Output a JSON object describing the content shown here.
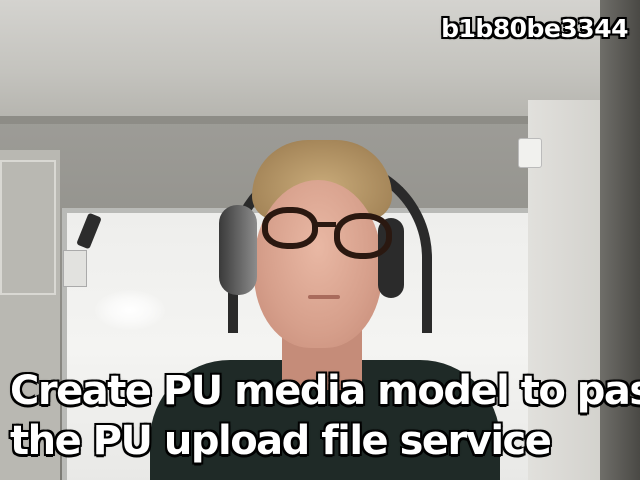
{
  "watermark": "b1b80be3344",
  "caption": {
    "lines": [
      "Create PU media model to pass",
      "the PU upload file service"
    ]
  }
}
